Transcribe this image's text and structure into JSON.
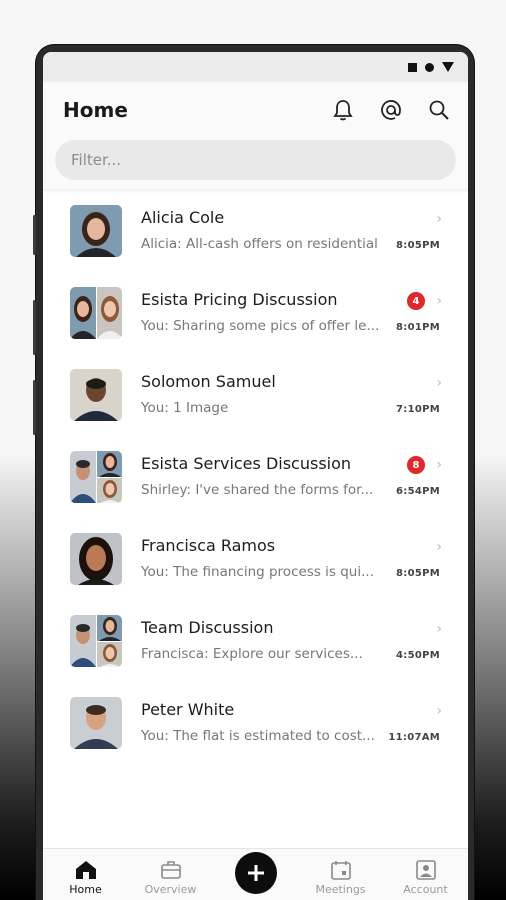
{
  "header": {
    "title": "Home"
  },
  "filter": {
    "placeholder": "Filter..."
  },
  "icons": {
    "notifications": "bell-icon",
    "mentions": "at-icon",
    "search": "search-icon"
  },
  "colors": {
    "badge": "#e0272b",
    "fab": "#0d0d0d"
  },
  "conversations": [
    {
      "name": "Alicia Cole",
      "preview": "Alicia: All-cash offers on residential",
      "time": "8:05PM",
      "badge": "",
      "avatar": "single"
    },
    {
      "name": "Esista Pricing Discussion",
      "preview": "You: Sharing some pics of offer le...",
      "time": "8:01PM",
      "badge": "4",
      "avatar": "group2"
    },
    {
      "name": "Solomon Samuel",
      "preview": "You: 1 Image",
      "time": "7:10PM",
      "badge": "",
      "avatar": "single"
    },
    {
      "name": "Esista Services Discussion",
      "preview": "Shirley: I've shared the forms for...",
      "time": "6:54PM",
      "badge": "8",
      "avatar": "group3"
    },
    {
      "name": "Francisca Ramos",
      "preview": "You: The financing process is qui...",
      "time": "8:05PM",
      "badge": "",
      "avatar": "single"
    },
    {
      "name": "Team Discussion",
      "preview": "Francisca: Explore our services...",
      "time": "4:50PM",
      "badge": "",
      "avatar": "group3"
    },
    {
      "name": "Peter White",
      "preview": "You:  The flat is estimated to cost...",
      "time": "11:07AM",
      "badge": "",
      "avatar": "single"
    }
  ],
  "nav": {
    "home": "Home",
    "overview": "Overview",
    "meetings": "Meetings",
    "account": "Account",
    "active": "Home"
  }
}
